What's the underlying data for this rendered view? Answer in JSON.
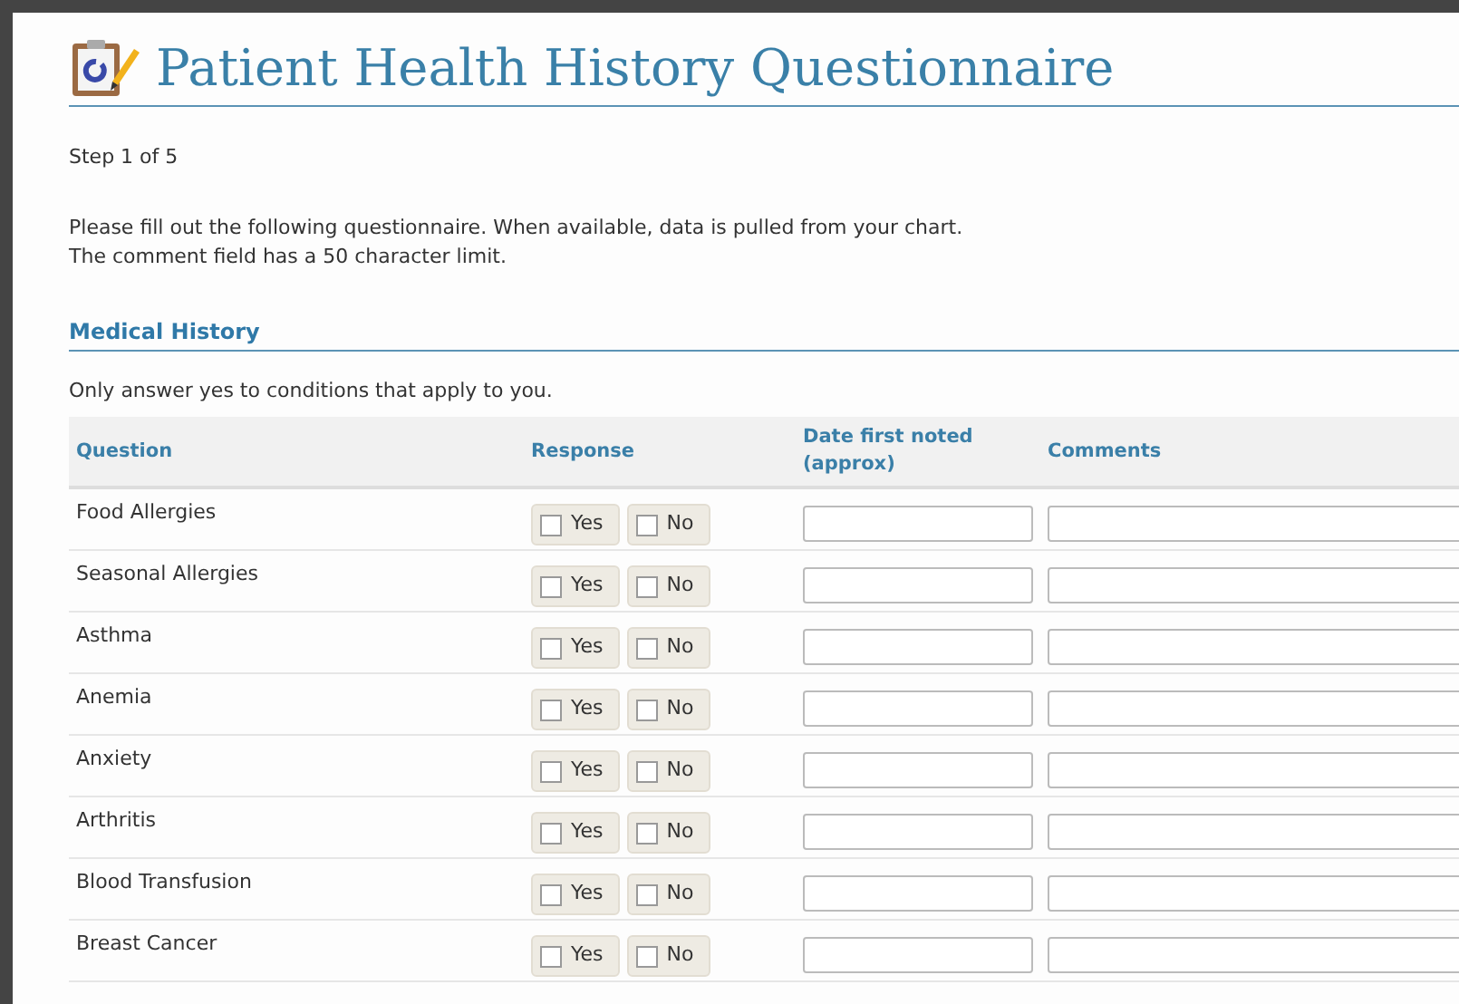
{
  "header": {
    "title": "Patient Health History Questionnaire"
  },
  "step": "Step 1 of 5",
  "intro": [
    "Please fill out the following questionnaire. When available, data is pulled from your chart.",
    "The comment field has a 50 character limit."
  ],
  "section": {
    "title": "Medical History",
    "note": "Only answer yes to conditions that apply to you."
  },
  "table": {
    "columns": [
      "Question",
      "Response",
      "Date first noted (approx)",
      "Comments"
    ],
    "rows": [
      {
        "question": "Food Allergies",
        "options": [
          {
            "label": "Yes",
            "checked": false
          },
          {
            "label": "No",
            "checked": false
          }
        ]
      },
      {
        "question": "Seasonal Allergies",
        "options": [
          {
            "label": "Yes",
            "checked": false
          },
          {
            "label": "No",
            "checked": false
          }
        ]
      },
      {
        "question": "Asthma",
        "options": [
          {
            "label": "Yes",
            "checked": false
          },
          {
            "label": "No",
            "checked": false
          }
        ]
      },
      {
        "question": "Anemia",
        "options": [
          {
            "label": "Yes",
            "checked": false
          },
          {
            "label": "No",
            "checked": false
          }
        ]
      },
      {
        "question": "Anxiety",
        "options": [
          {
            "label": "Yes",
            "checked": false
          },
          {
            "label": "No",
            "checked": false
          }
        ]
      },
      {
        "question": "Arthritis",
        "options": [
          {
            "label": "Yes",
            "checked": false
          },
          {
            "label": "No",
            "checked": false
          }
        ]
      },
      {
        "question": "Blood Transfusion",
        "options": [
          {
            "label": "Yes",
            "checked": false
          },
          {
            "label": "No",
            "checked": false
          }
        ]
      },
      {
        "question": "Breast Cancer",
        "options": [
          {
            "label": "Yes",
            "checked": false
          },
          {
            "label": "No",
            "checked": false
          }
        ]
      }
    ]
  }
}
